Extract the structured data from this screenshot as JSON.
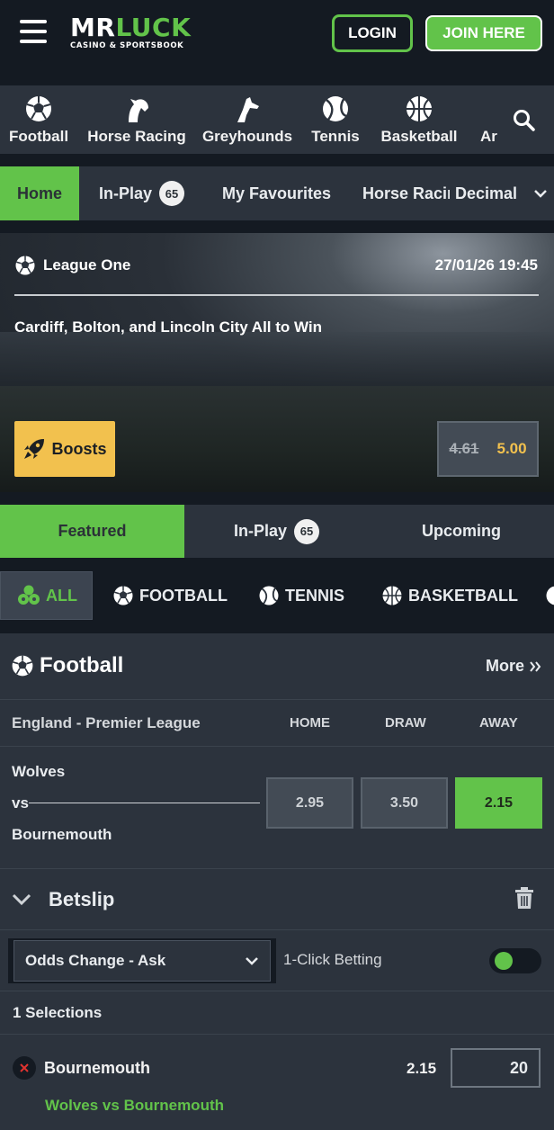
{
  "header": {
    "logo_main_1": "MR",
    "logo_main_2": "LUCK",
    "logo_sub": "CASINO & SPORTSBOOK",
    "login_label": "LOGIN",
    "join_label": "JOIN HERE",
    "accent_color": "#62c34a"
  },
  "sports_nav": {
    "items": [
      {
        "label": "Football",
        "icon": "football-icon"
      },
      {
        "label": "Horse Racing",
        "icon": "horse-icon"
      },
      {
        "label": "Greyhounds",
        "icon": "greyhound-icon"
      },
      {
        "label": "Tennis",
        "icon": "tennis-icon"
      },
      {
        "label": "Basketball",
        "icon": "basketball-icon"
      },
      {
        "label": "Ar",
        "icon": ""
      }
    ],
    "search_icon": "search-icon"
  },
  "tabs": {
    "items": [
      {
        "label": "Home",
        "active": true
      },
      {
        "label": "In-Play",
        "badge": "65"
      },
      {
        "label": "My Favourites"
      },
      {
        "label": "Horse Racing"
      }
    ],
    "odds_format": "Decimal"
  },
  "hero": {
    "league": "League One",
    "datetime": "27/01/26 19:45",
    "title": "Cardiff, Bolton, and Lincoln City All to Win",
    "boosts_label": "Boosts",
    "old_odds": "4.61",
    "new_odds": "5.00"
  },
  "featured_tabs": {
    "items": [
      {
        "label": "Featured",
        "active": true
      },
      {
        "label": "In-Play",
        "badge": "65"
      },
      {
        "label": "Upcoming"
      }
    ]
  },
  "filters": {
    "items": [
      {
        "label": "ALL",
        "active": true
      },
      {
        "label": "FOOTBALL"
      },
      {
        "label": "TENNIS"
      },
      {
        "label": "BASKETBALL"
      }
    ]
  },
  "football_section": {
    "title": "Football",
    "more_label": "More",
    "league": "England - Premier League",
    "columns": [
      "HOME",
      "DRAW",
      "AWAY"
    ],
    "match": {
      "home": "Wolves",
      "vs": "vs",
      "away": "Bournemouth",
      "prices": [
        "2.95",
        "3.50",
        "2.15"
      ],
      "selected_index": 2
    }
  },
  "betslip": {
    "title": "Betslip",
    "odds_change_option": "Odds Change - Ask",
    "one_click_label": "1-Click Betting",
    "selections_label": "1 Selections",
    "selection": {
      "name": "Bournemouth",
      "odds": "2.15",
      "stake": "20",
      "event": "Wolves vs Bournemouth"
    }
  }
}
